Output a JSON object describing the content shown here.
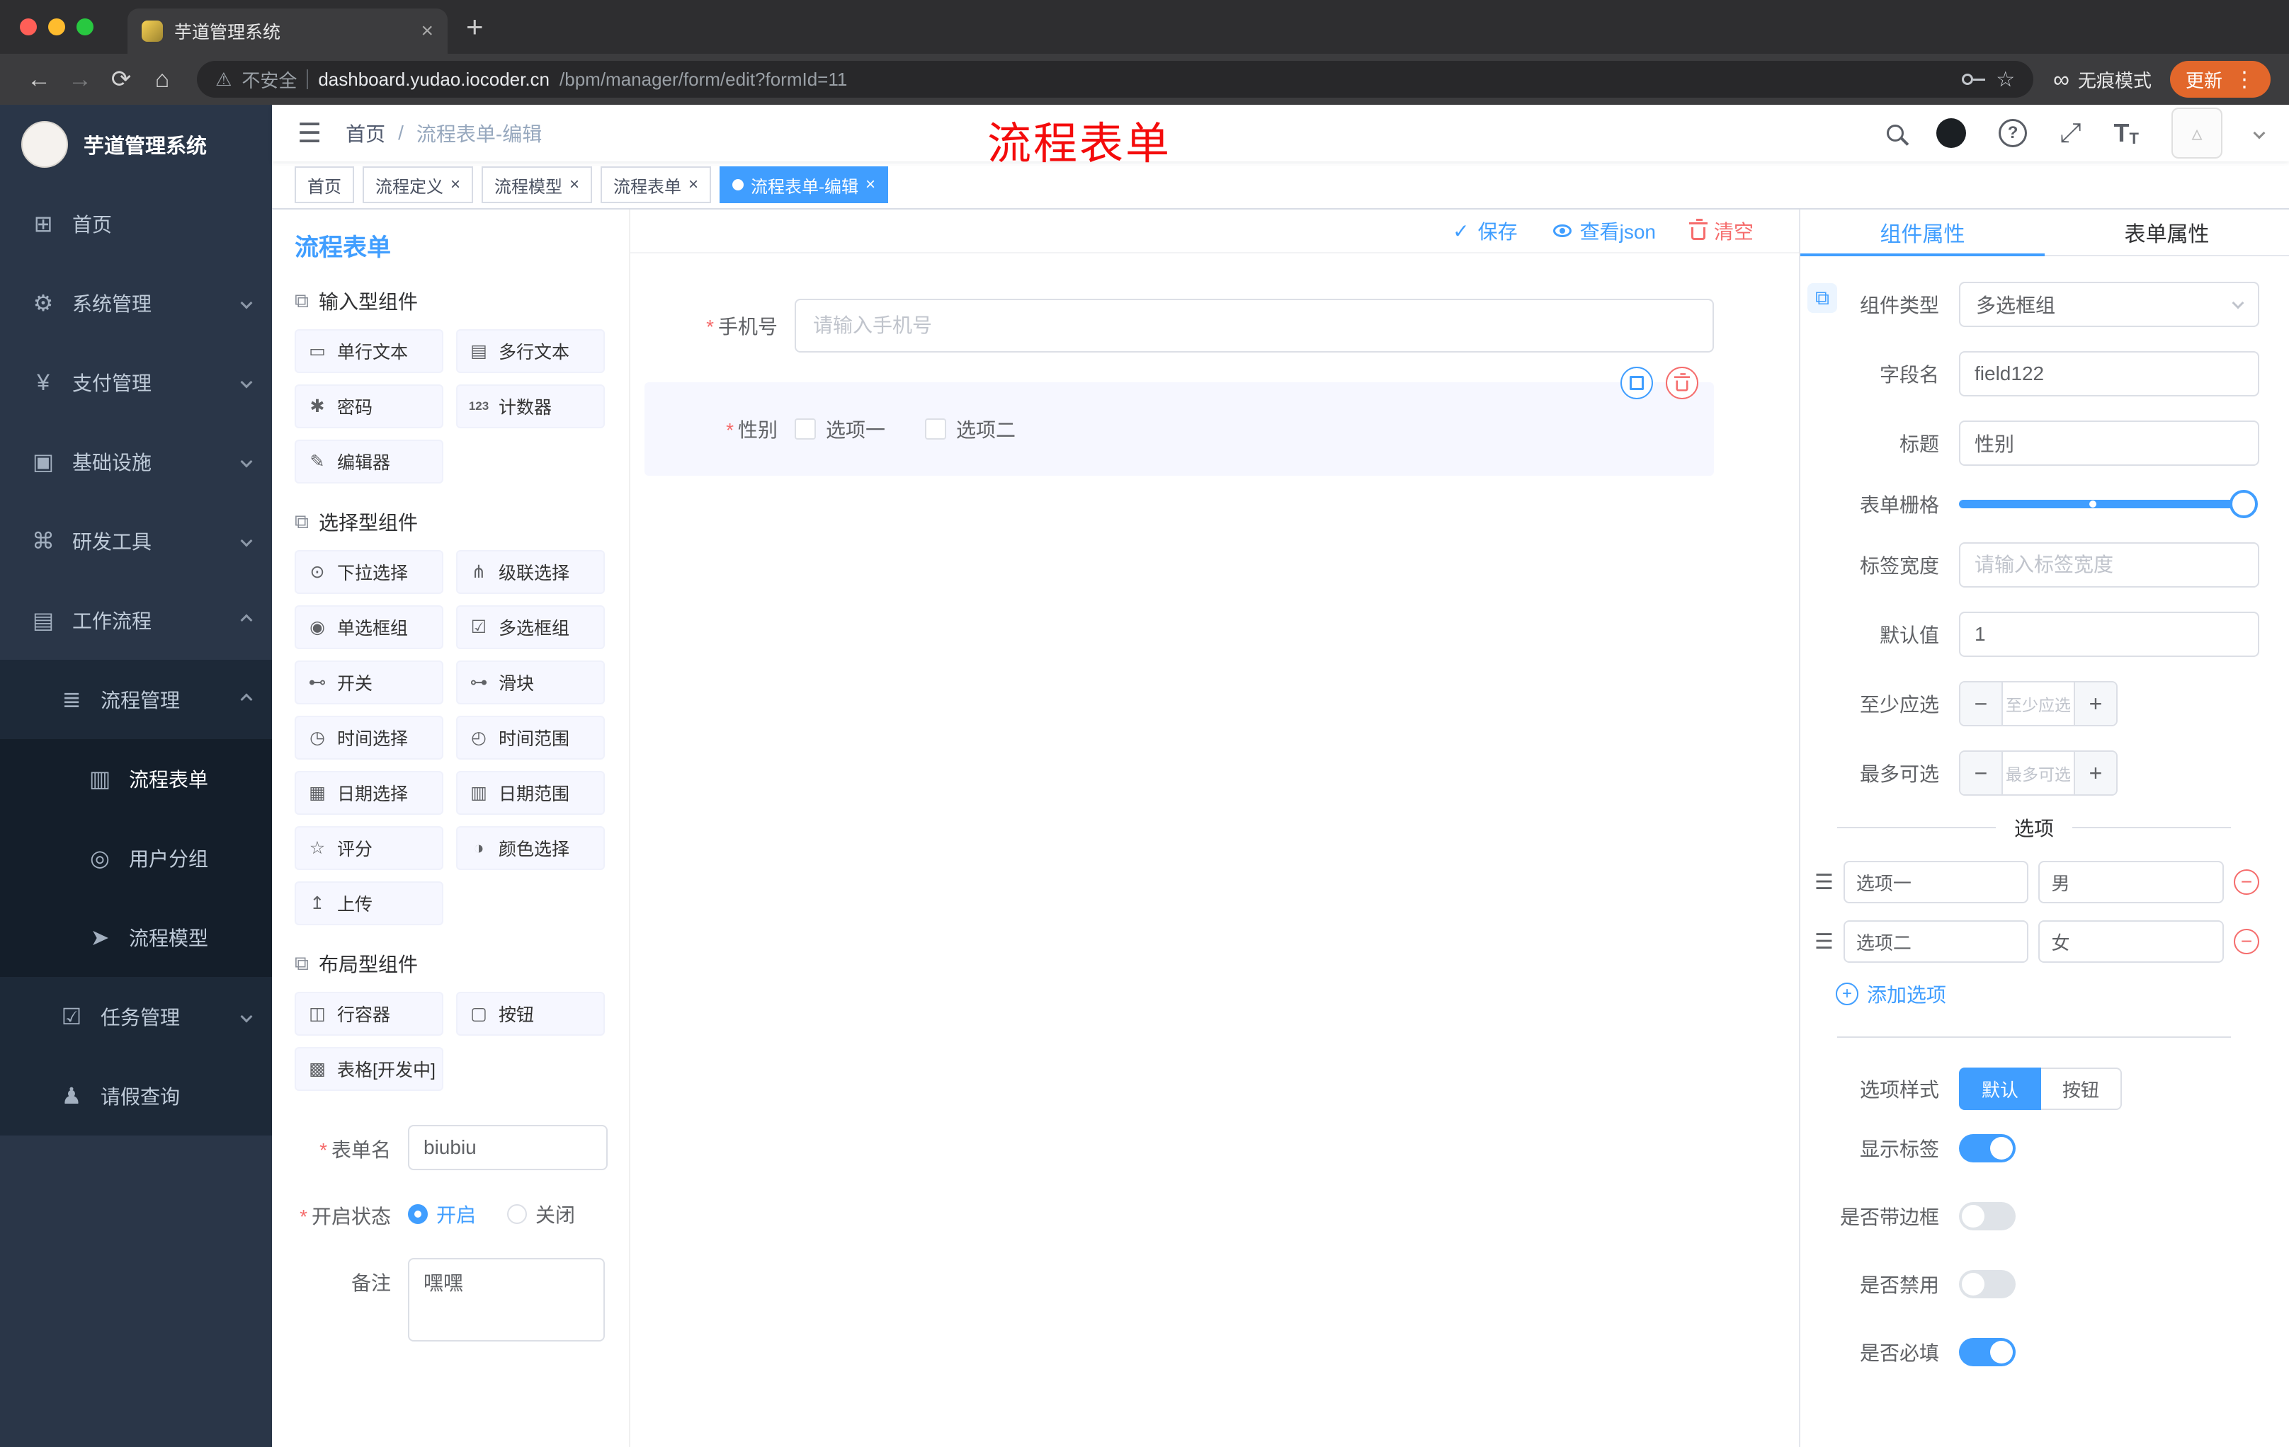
{
  "browser": {
    "tab_title": "芋道管理系统",
    "security_label": "不安全",
    "url_host": "dashboard.yudao.iocoder.cn",
    "url_path": "/bpm/manager/form/edit?formId=11",
    "incognito_label": "无痕模式",
    "update_label": "更新"
  },
  "sidebar": {
    "logo_title": "芋道管理系统",
    "items": [
      {
        "label": "首页"
      },
      {
        "label": "系统管理"
      },
      {
        "label": "支付管理"
      },
      {
        "label": "基础设施"
      },
      {
        "label": "研发工具"
      },
      {
        "label": "工作流程"
      },
      {
        "label": "流程管理"
      },
      {
        "label": "流程表单"
      },
      {
        "label": "用户分组"
      },
      {
        "label": "流程模型"
      },
      {
        "label": "任务管理"
      },
      {
        "label": "请假查询"
      }
    ]
  },
  "header": {
    "breadcrumb_home": "首页",
    "breadcrumb_sep": "/",
    "breadcrumb_current": "流程表单-编辑",
    "annotation": "流程表单"
  },
  "tags": [
    {
      "label": "首页"
    },
    {
      "label": "流程定义"
    },
    {
      "label": "流程模型"
    },
    {
      "label": "流程表单"
    },
    {
      "label": "流程表单-编辑"
    }
  ],
  "palette": {
    "title": "流程表单",
    "groups": [
      {
        "label": "输入型组件",
        "items": [
          {
            "label": "单行文本"
          },
          {
            "label": "多行文本"
          },
          {
            "label": "密码"
          },
          {
            "label": "计数器"
          },
          {
            "label": "编辑器"
          }
        ]
      },
      {
        "label": "选择型组件",
        "items": [
          {
            "label": "下拉选择"
          },
          {
            "label": "级联选择"
          },
          {
            "label": "单选框组"
          },
          {
            "label": "多选框组"
          },
          {
            "label": "开关"
          },
          {
            "label": "滑块"
          },
          {
            "label": "时间选择"
          },
          {
            "label": "时间范围"
          },
          {
            "label": "日期选择"
          },
          {
            "label": "日期范围"
          },
          {
            "label": "评分"
          },
          {
            "label": "颜色选择"
          },
          {
            "label": "上传"
          }
        ]
      },
      {
        "label": "布局型组件",
        "items": [
          {
            "label": "行容器"
          },
          {
            "label": "按钮"
          },
          {
            "label": "表格[开发中]"
          }
        ]
      }
    ],
    "form": {
      "name_label": "表单名",
      "name_value": "biubiu",
      "status_label": "开启状态",
      "status_on": "开启",
      "status_off": "关闭",
      "remark_label": "备注",
      "remark_value": "嘿嘿"
    }
  },
  "canvas": {
    "save_label": "保存",
    "view_json_label": "查看json",
    "clear_label": "清空",
    "phone_label": "手机号",
    "phone_placeholder": "请输入手机号",
    "gender_label": "性别",
    "gender_options": [
      {
        "label": "选项一"
      },
      {
        "label": "选项二"
      }
    ]
  },
  "props": {
    "tab_component": "组件属性",
    "tab_form": "表单属性",
    "rows": {
      "component_type_label": "组件类型",
      "component_type_value": "多选框组",
      "field_name_label": "字段名",
      "field_name_value": "field122",
      "title_label": "标题",
      "title_value": "性别",
      "grid_label": "表单栅格",
      "tag_width_label": "标签宽度",
      "tag_width_placeholder": "请输入标签宽度",
      "default_label": "默认值",
      "default_value": "1",
      "min_label": "至少应选",
      "min_placeholder": "至少应选",
      "max_label": "最多可选",
      "max_placeholder": "最多可选"
    },
    "options_title": "选项",
    "options": [
      {
        "name": "选项一",
        "value": "男"
      },
      {
        "name": "选项二",
        "value": "女"
      }
    ],
    "add_option_label": "添加选项",
    "style_label": "选项样式",
    "style_options": [
      {
        "label": "默认"
      },
      {
        "label": "按钮"
      }
    ],
    "show_label": "显示标签",
    "border_label": "是否带边框",
    "disabled_label": "是否禁用",
    "required_label": "是否必填"
  },
  "colors": {
    "primary": "#409EFF",
    "danger": "#F56C6C",
    "annotation_red": "#F40B0B",
    "sidebar_bg": "#2A3648"
  }
}
